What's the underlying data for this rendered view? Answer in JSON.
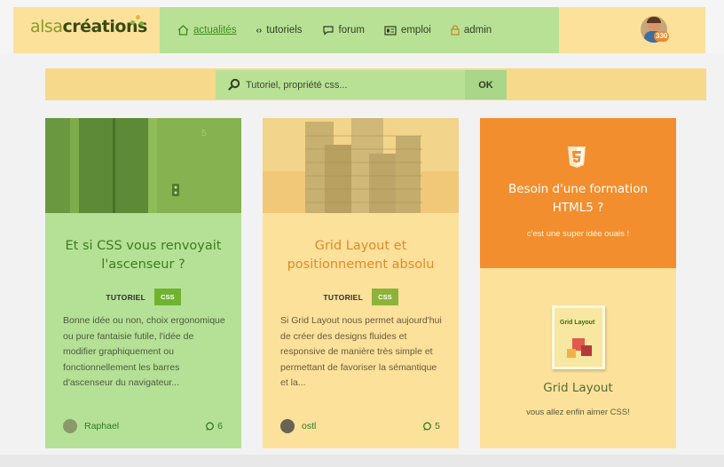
{
  "header": {
    "logo": {
      "part1": "alsa",
      "part2": "créations"
    },
    "nav": [
      {
        "label": "actualités",
        "icon": "home-icon",
        "active": true
      },
      {
        "label": "tutoriels",
        "icon": "code-icon",
        "active": false
      },
      {
        "label": "forum",
        "icon": "chat-icon",
        "active": false
      },
      {
        "label": "emploi",
        "icon": "id-card-icon",
        "active": false
      },
      {
        "label": "admin",
        "icon": "lock-icon",
        "active": false
      }
    ],
    "user_badge": "330"
  },
  "search": {
    "placeholder": "Tutoriel, propriété css...",
    "button_label": "OK"
  },
  "cards": [
    {
      "title": "Et si CSS vous renvoyait l'ascenseur ?",
      "type_label": "TUTORIEL",
      "tag": "CSS",
      "excerpt": "Bonne idée ou non, choix ergonomique ou pure fantaisie futile, l'idée de modifier graphiquement ou fonctionnellement les barres d'ascenseur du navigateur...",
      "author": "Raphael",
      "comments": "6"
    },
    {
      "title": "Grid Layout et positionnement absolu",
      "type_label": "TUTORIEL",
      "tag": "CSS",
      "excerpt": "Si Grid Layout nous permet aujourd'hui de créer des designs fluides et responsive de manière très simple et permettant de favoriser la sémantique et la...",
      "author": "ostl",
      "comments": "5"
    }
  ],
  "promo": {
    "title": "Besoin d'une formation HTML5 ?",
    "subtitle": "c'est une super idée ouais !",
    "book_title": "Grid Layout",
    "book_subtitle": "vous allez enfin aimer CSS!"
  },
  "colors": {
    "green_panel": "#b5e196",
    "yellow_panel": "#fbe19a",
    "orange": "#f28e2e",
    "tag_green": "#6fb330"
  }
}
